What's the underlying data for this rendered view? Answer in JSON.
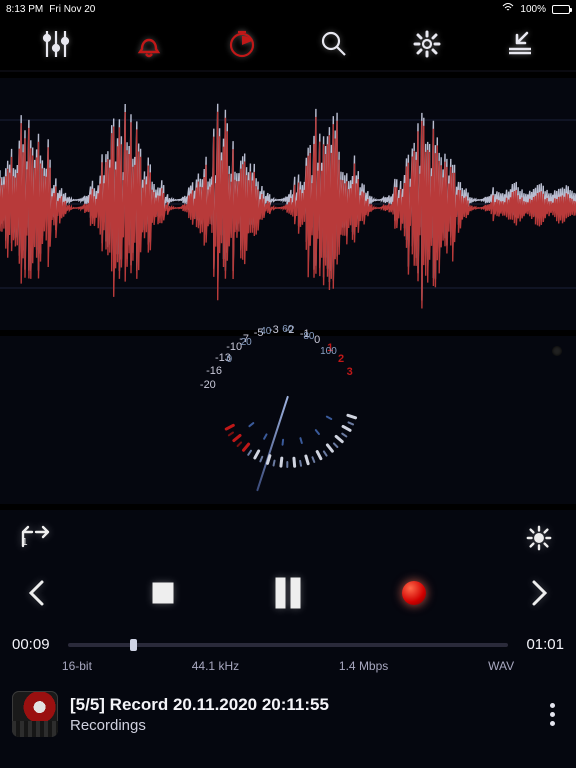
{
  "statusbar": {
    "time": "8:13 PM",
    "date": "Fri Nov 20",
    "battery_pct": "100%"
  },
  "topbar": {
    "icons": [
      "sliders",
      "bell",
      "clock",
      "search",
      "gear",
      "collapse"
    ]
  },
  "meter": {
    "outer_labels": [
      "-20",
      "-16",
      "-13",
      "-10",
      "-7",
      "-5",
      "-3",
      "-2",
      "-1",
      "0"
    ],
    "red_labels": [
      "1",
      "2",
      "3"
    ],
    "inner_labels": [
      "0",
      "20",
      "40",
      "60",
      "80",
      "100"
    ]
  },
  "transport": {
    "time_elapsed": "00:09",
    "time_total": "01:01",
    "progress_pct": 14,
    "format_bits": "16-bit",
    "format_rate": "44.1 kHz",
    "format_bitrate": "1.4 Mbps",
    "format_codec": "WAV"
  },
  "file": {
    "title": "[5/5] Record 20.11.2020 20:11:55",
    "folder": "Recordings"
  }
}
